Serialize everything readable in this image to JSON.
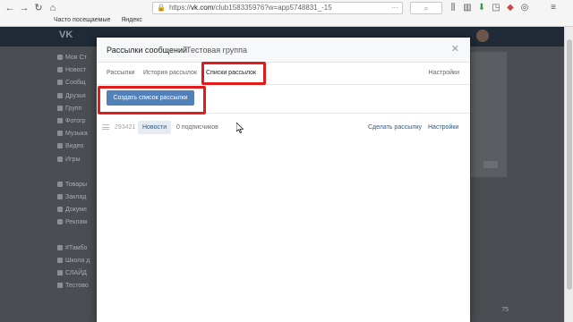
{
  "browser": {
    "url_prefix": "https://",
    "url_domain": "vk.com",
    "url_rest": "/club158335976?w=app5748831_-15",
    "bookmarks": [
      "Часто посещаемые",
      "Яндекс"
    ],
    "search_icon": "magnifier-icon"
  },
  "vk": {
    "logo": "VK",
    "sidebar_items": [
      "Моя Ст",
      "Новост",
      "Сообщ",
      "Друзья",
      "Групп",
      "Фотогр",
      "Музыка",
      "Видео",
      "Игры",
      "",
      "Товары",
      "Заклад",
      "Докуме",
      "Реклам",
      "",
      "#Тамбо",
      "Школа д",
      "СЛАЙД",
      "Тестово"
    ],
    "zoom": "75"
  },
  "modal": {
    "title": "Рассылки сообщений",
    "subtitle": "Тестовая группа",
    "close": "✕",
    "tabs": [
      "Рассылки",
      "История рассылок",
      "Списки рассылок"
    ],
    "active_tab": 2,
    "settings_tab": "Настройки",
    "create_button": "Создать список рассылки",
    "lists": [
      {
        "id": "293421",
        "name": "Новости",
        "subscribers": "0 подписчиков",
        "send_link": "Сделать рассылку",
        "settings_link": "Настройки"
      }
    ]
  },
  "colors": {
    "accent": "#5181b8",
    "link": "#2a5885",
    "highlight": "#e21b1b"
  }
}
